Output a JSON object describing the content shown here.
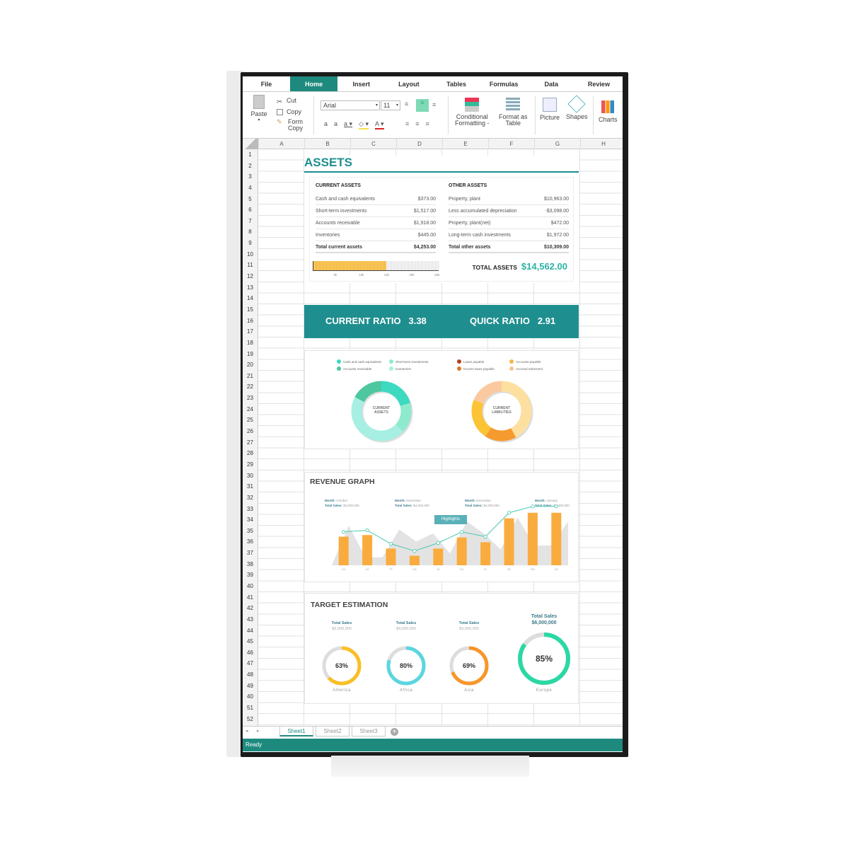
{
  "colors": {
    "accent": "#1e8a7e",
    "teal_banner": "#1f8e8f",
    "bar_orange": "#f9ac3d",
    "line_teal": "#48c9b0"
  },
  "ribbon": {
    "tabs": [
      "File",
      "Home",
      "Insert",
      "Layout",
      "Tables",
      "Formulas",
      "Data",
      "Review"
    ],
    "active_tab": "Home",
    "paste": "Paste",
    "cut": "Cut",
    "copy": "Copy",
    "form_copy_1": "Form",
    "form_copy_2": "Copy",
    "font": "Arial",
    "size": "11",
    "conditional_1": "Conditional",
    "conditional_2": "Formatting -",
    "format_table_1": "Format as",
    "format_table_2": "Table",
    "picture": "Picture",
    "shapes": "Shapes",
    "charts": "Charts"
  },
  "columns": [
    "A",
    "B",
    "C",
    "D",
    "E",
    "F",
    "G",
    "H"
  ],
  "rows": [
    "1",
    "2",
    "3",
    "4",
    "5",
    "6",
    "7",
    "8",
    "9",
    "10",
    "11",
    "12",
    "13",
    "14",
    "15",
    "16",
    "17",
    "18",
    "19",
    "20",
    "21",
    "22",
    "23",
    "24",
    "25",
    "26",
    "27",
    "28",
    "29",
    "30",
    "31",
    "32",
    "33",
    "34",
    "35",
    "36",
    "37",
    "38",
    "39",
    "40",
    "41",
    "42",
    "43",
    "44",
    "45",
    "46",
    "47",
    "48",
    "49",
    "40",
    "51",
    "52"
  ],
  "assets": {
    "title": "ASSETS",
    "current_header": "CURRENT ASSETS",
    "current": [
      [
        "Cash and cash equivalents",
        "$373.00"
      ],
      [
        "Short-term investments",
        "$1,517.00"
      ],
      [
        "Accounts receivable",
        "$1,918.00"
      ],
      [
        "Inventories",
        "$445.00"
      ]
    ],
    "current_total": [
      "Total current assets",
      "$4,253.00"
    ],
    "other_header": "OTHER ASSETS",
    "other": [
      [
        "Property, plant",
        "$10,963.00"
      ],
      [
        "Less accumulated depreciation",
        "-$3,098.00"
      ],
      [
        "Property, plant(net)",
        "$472.00"
      ],
      [
        "Long-term cash investments",
        "$1,972.00"
      ]
    ],
    "other_total": [
      "Total other assets",
      "$10,309.00"
    ],
    "bar_ticks": [
      "5k",
      "10k",
      "15k",
      "20k",
      "25k"
    ],
    "bar_value_k": 14.562,
    "bar_max_k": 25,
    "total_label": "TOTAL ASSETS",
    "total_value": "$14,562.00"
  },
  "ratios": {
    "current_label": "CURRENT RATIO",
    "current_value": "3.38",
    "quick_label": "QUICK RATIO",
    "quick_value": "2.91"
  },
  "donuts": [
    {
      "center_1": "CURRENT",
      "center_2": "ASSETS",
      "legend": [
        {
          "name": "Cash and cash equivalents",
          "color": "#3dd9c1",
          "share": 19
        },
        {
          "name": "Short-term investments",
          "color": "#8eeacc",
          "share": 15
        },
        {
          "name": "Accounts receivable",
          "color": "#4cc7a0",
          "share": 16
        },
        {
          "name": "Inventories",
          "color": "#a6efe2",
          "share": 42
        }
      ],
      "order": [
        0,
        1,
        3,
        2
      ]
    },
    {
      "center_1": "CURRENT",
      "center_2": "LIABILITIES",
      "legend": [
        {
          "name": "Loans payable",
          "color": "#b5431d",
          "share": 0
        },
        {
          "name": "Accounts payable",
          "color": "#f5b64a",
          "share": 0
        },
        {
          "name": "Income taxes payable",
          "color": "#d97a2a",
          "share": 0
        },
        {
          "name": "Accrued retirement",
          "color": "#f7c48f",
          "share": 0
        }
      ],
      "segments": [
        {
          "color": "#fde0a0",
          "share": 42
        },
        {
          "color": "#f59a2e",
          "share": 17
        },
        {
          "color": "#fcc434",
          "share": 22
        },
        {
          "color": "#fbc9a0",
          "share": 19
        }
      ]
    }
  ],
  "revenue": {
    "title": "REVENUE GRAPH",
    "highlights": "Highlights",
    "callouts": [
      {
        "month": "October",
        "sales": "$3,000,000"
      },
      {
        "month": "November",
        "sales": "$4,000,000"
      },
      {
        "month": "December",
        "sales": "$4,000,000"
      },
      {
        "month": "January",
        "sales": "$4,000,000"
      }
    ],
    "month_label": "Month: ",
    "sales_label": "Total Sales: ",
    "chart_data": {
      "type": "bar",
      "categories": [
        "SU",
        "LR",
        "TF",
        "OA",
        "JE",
        "SU",
        "EI",
        "SE",
        "PAI",
        "UR"
      ],
      "bars": [
        36,
        38,
        21,
        12,
        21,
        35,
        29,
        59,
        66,
        66
      ],
      "line": [
        42,
        44,
        27,
        18,
        28,
        42,
        36,
        66,
        74,
        74
      ],
      "area": [
        0,
        50,
        10,
        10,
        45,
        30,
        40,
        15,
        55,
        40,
        20,
        60,
        25,
        25,
        55
      ],
      "ymax": 80
    }
  },
  "target": {
    "title": "TARGET ESTIMATION",
    "label": "Total Sales",
    "items": [
      {
        "region": "America",
        "sales": "$2,000,000",
        "pct": 63,
        "pct_label": "63%",
        "color": "#fbbf26"
      },
      {
        "region": "Africa",
        "sales": "$4,000,000",
        "pct": 80,
        "pct_label": "80%",
        "color": "#5ad6e0"
      },
      {
        "region": "Asia",
        "sales": "$3,000,000",
        "pct": 69,
        "pct_label": "69%",
        "color": "#f7962a"
      },
      {
        "region": "Europe",
        "sales": "$6,000,000",
        "pct": 85,
        "pct_label": "85%",
        "color": "#2bd8a4"
      }
    ]
  },
  "sheets": [
    "Sheet1",
    "Sheet2",
    "Sheet3"
  ],
  "status": "Ready"
}
